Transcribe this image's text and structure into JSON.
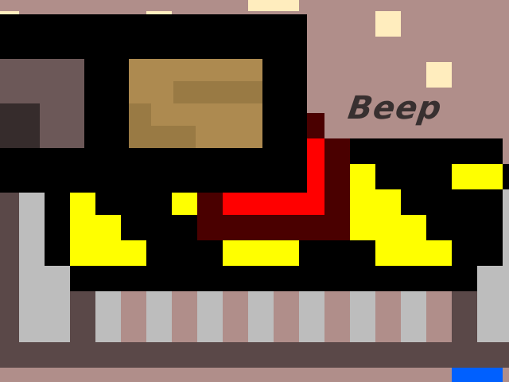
{
  "scene": {
    "speech_label": "Beep",
    "colors": {
      "wall": "#b08e8a",
      "black": "#000000",
      "yellow": "#ffff00",
      "red": "#ff0000",
      "dark_red": "#4a0000",
      "gray": "#bdbdbd",
      "dark_brown": "#5a4848",
      "star": "#ffedbe",
      "blue": "#0060ff",
      "crate": "#ad8a50"
    }
  }
}
